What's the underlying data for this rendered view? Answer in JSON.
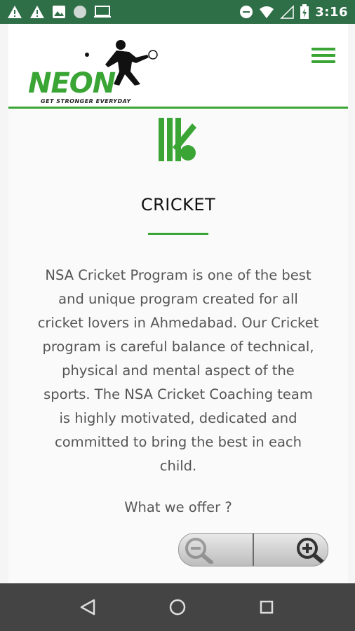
{
  "status_bar": {
    "time": "3:16",
    "left_icons": [
      "warning-icon",
      "warning-icon",
      "image-icon",
      "circle-icon",
      "screen-cast-icon"
    ],
    "right_icons": [
      "do-not-disturb-icon",
      "wifi-icon",
      "signal-icon",
      "battery-icon"
    ]
  },
  "header": {
    "logo_text": "NEON",
    "logo_tagline": "GET STRONGER EVERYDAY",
    "menu_icon": "hamburger-menu-icon"
  },
  "content": {
    "sport_icon": "cricket-stumps-icon",
    "title": "CRICKET",
    "description": "NSA Cricket Program is one of the best and unique program created for all cricket lovers in Ahmedabad. Our Cricket program is careful balance of technical, physical and mental aspect of the sports. The NSA Cricket Coaching team is highly motivated, dedicated and committed to bring the best in each child.",
    "offer_heading": "What we offer ?"
  },
  "zoom_control": {
    "zoom_out_icon": "zoom-out-icon",
    "zoom_in_icon": "zoom-in-icon"
  },
  "nav_bar": {
    "back_icon": "back-triangle-icon",
    "home_icon": "home-circle-icon",
    "recents_icon": "recents-square-icon"
  },
  "colors": {
    "status_bar": "#2f6f47",
    "accent_green": "#3aa535",
    "nav_bar": "#444444"
  }
}
